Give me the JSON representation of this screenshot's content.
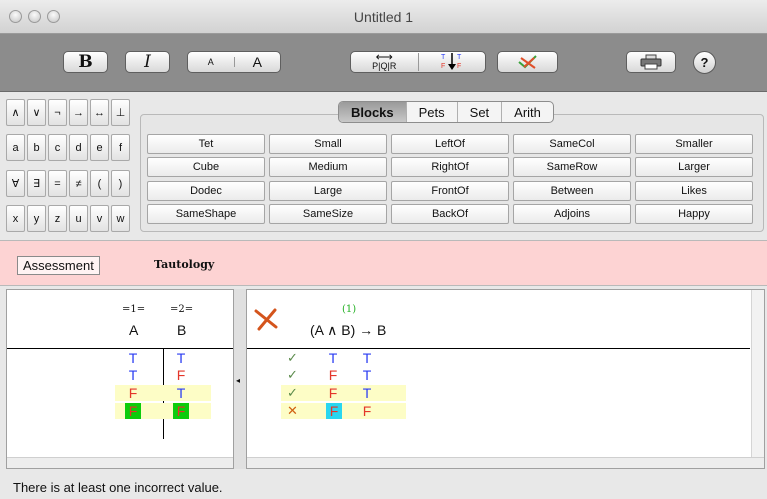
{
  "window": {
    "title": "Untitled 1"
  },
  "toolbar": {
    "bold": "B",
    "italic": "I",
    "font_small": "A",
    "font_large": "A",
    "pqr_label": "P|Q|R",
    "help": "?"
  },
  "keypad": [
    [
      "∧",
      "∨",
      "¬",
      "→",
      "↔",
      "⊥"
    ],
    [
      "a",
      "b",
      "c",
      "d",
      "e",
      "f"
    ],
    [
      "∀",
      "∃",
      "=",
      "≠",
      "(",
      ")"
    ],
    [
      "x",
      "y",
      "z",
      "u",
      "v",
      "w"
    ]
  ],
  "tabs": [
    "Blocks",
    "Pets",
    "Set",
    "Arith"
  ],
  "active_tab": "Blocks",
  "predicates": [
    [
      "Tet",
      "Small",
      "LeftOf",
      "SameCol",
      "Smaller"
    ],
    [
      "Cube",
      "Medium",
      "RightOf",
      "SameRow",
      "Larger"
    ],
    [
      "Dodec",
      "Large",
      "FrontOf",
      "Between",
      "Likes"
    ],
    [
      "SameShape",
      "SameSize",
      "BackOf",
      "Adjoins",
      "Happy"
    ]
  ],
  "assessment": {
    "button": "Assessment",
    "result": "Tautology"
  },
  "reference_columns": [
    {
      "num": "=1=",
      "head": "A"
    },
    {
      "num": "=2=",
      "head": "B"
    }
  ],
  "reference_rows": [
    [
      "T",
      "T"
    ],
    [
      "T",
      "F"
    ],
    [
      "F",
      "T"
    ],
    [
      "F",
      "F"
    ]
  ],
  "formula": {
    "col_num": "(1)",
    "text": "(A ∧ B) → B"
  },
  "result_rows": [
    {
      "mark": "✓",
      "cells": [
        "T",
        "T"
      ]
    },
    {
      "mark": "✓",
      "cells": [
        "F",
        "T"
      ]
    },
    {
      "mark": "✓",
      "cells": [
        "F",
        "T"
      ]
    },
    {
      "mark": "✕",
      "cells": [
        "F",
        "F"
      ]
    }
  ],
  "status": "There is at least one incorrect value.",
  "colors": {
    "true": "#2a3cf2",
    "false": "#e4362a",
    "highlight": "#fdfdc6",
    "assessment_bg": "#fdd3d3"
  }
}
